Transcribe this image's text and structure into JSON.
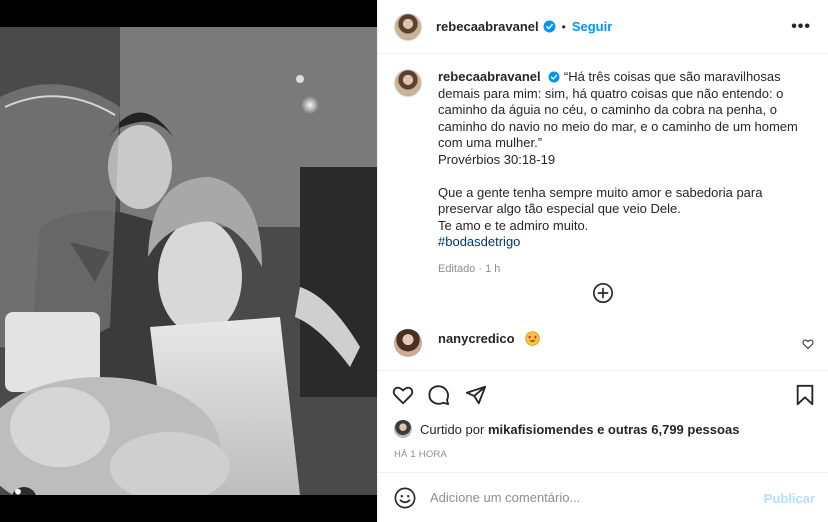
{
  "post": {
    "author": "rebecaabravanel",
    "follow_label": "Seguir",
    "separator": "•",
    "more_label": "•••"
  },
  "caption": {
    "username": "rebecaabravanel",
    "line1": "“Há três coisas que são maravilhosas demais para mim: sim, há quatro coisas que não entendo: o caminho da águia no céu, o caminho da cobra na penha, o caminho do navio no meio do mar, e o caminho de um homem com uma mulher.”",
    "line2": "Provérbios 30:18-19",
    "line3": "Que a gente tenha sempre muito amor e sabedoria para preservar algo tão especial que veio Dele.",
    "line4": "Te amo e te admiro muito.",
    "hashtag": "#bodasdetrigo",
    "edited": "Editado · 1 h"
  },
  "comment": {
    "username": "nanycredico",
    "emoji": "heart-eyes"
  },
  "likes": {
    "prefix": "Curtido por",
    "user": "mikafisiomendes",
    "suffix": "e outras 6,799 pessoas"
  },
  "time": "HÁ 1 HORA",
  "composer": {
    "placeholder": "Adicione um comentário...",
    "publish_label": "Publicar"
  },
  "colors": {
    "accent": "#0095f6",
    "publish_disabled": "#b2dffc",
    "hashtag": "#00376b",
    "muted": "#8e8e8e"
  }
}
